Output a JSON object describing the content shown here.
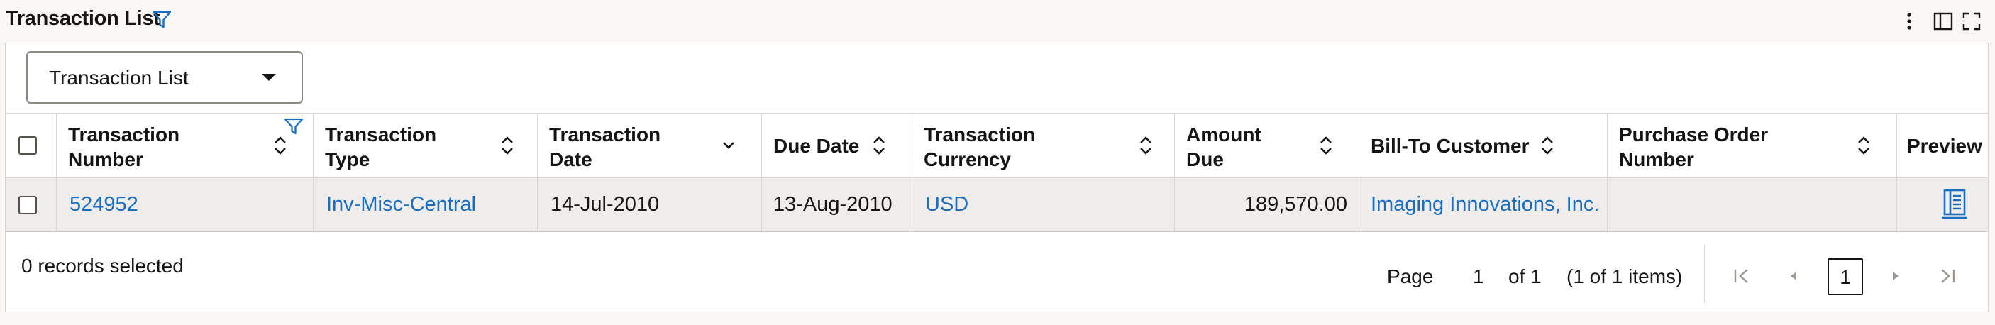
{
  "header": {
    "title": "Transaction List",
    "icons": [
      "filter-icon",
      "more-vertical-icon",
      "panel-toggle-icon",
      "fullscreen-icon"
    ]
  },
  "view_selector": {
    "value": "Transaction List"
  },
  "table": {
    "columns": [
      {
        "label": "Transaction\nNumber",
        "sortable": true,
        "filtered": true
      },
      {
        "label": "Transaction\nType",
        "sortable": true
      },
      {
        "label": "Transaction\nDate",
        "sortable": true,
        "sort_direction": "descending"
      },
      {
        "label": "Due Date",
        "sortable": true
      },
      {
        "label": "Transaction\nCurrency",
        "sortable": true
      },
      {
        "label": "Amount\nDue",
        "sortable": true
      },
      {
        "label": "Bill-To Customer",
        "sortable": true
      },
      {
        "label": "Purchase Order\nNumber",
        "sortable": true
      },
      {
        "label": "Preview",
        "sortable": false
      }
    ],
    "rows": [
      {
        "transaction_number": "524952",
        "transaction_type": "Inv-Misc-Central",
        "transaction_date": "14-Jul-2010",
        "due_date": "13-Aug-2010",
        "transaction_currency": "USD",
        "amount_due": "189,570.00",
        "bill_to_customer": "Imaging Innovations, Inc.",
        "purchase_order_number": "",
        "preview_icon": "document-preview-icon"
      }
    ]
  },
  "footer": {
    "records_selected": "0 records selected",
    "page_label": "Page",
    "page_input": "1",
    "page_of": "of 1",
    "items_summary": "(1 of 1 items)",
    "current_page": "1"
  },
  "colors": {
    "link": "#1a6ebf",
    "filter_icon": "#1a6ebf",
    "row_bg": "#eeedeb",
    "disabled_nav": "#9c9995"
  }
}
